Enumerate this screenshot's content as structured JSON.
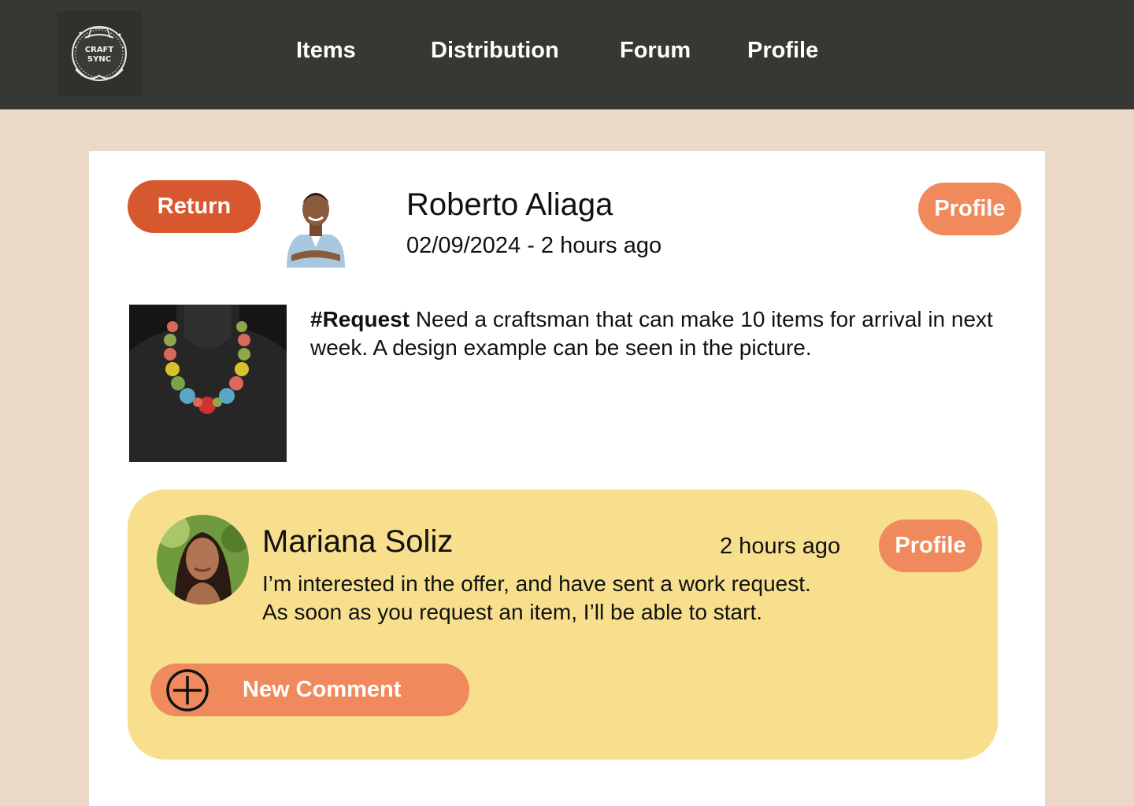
{
  "nav": {
    "logo_text": [
      "CRAFT",
      "SYNC"
    ],
    "items": [
      "Items",
      "Distribution",
      "Forum",
      "Profile"
    ]
  },
  "post": {
    "return_label": "Return",
    "author_name": "Roberto Aliaga",
    "author_date": "02/09/2024 - 2 hours ago",
    "profile_label": "Profile",
    "tag": "#Request",
    "body": " Need a craftsman that can make 10 items for arrival in next week. A design example can be seen in the picture."
  },
  "comment": {
    "author_name": "Mariana Soliz",
    "time": "2 hours ago",
    "profile_label": "Profile",
    "body_line1": "I’m interested in the offer, and have sent a work request.",
    "body_line2": "As soon as you request an item, I’ll be able to start."
  },
  "new_comment_label": "New Comment",
  "colors": {
    "topbar": "#363833",
    "background": "#e9d9c6",
    "return_button": "#d7582f",
    "profile_button": "#f08a5d",
    "comment_box": "#f7df8d"
  }
}
